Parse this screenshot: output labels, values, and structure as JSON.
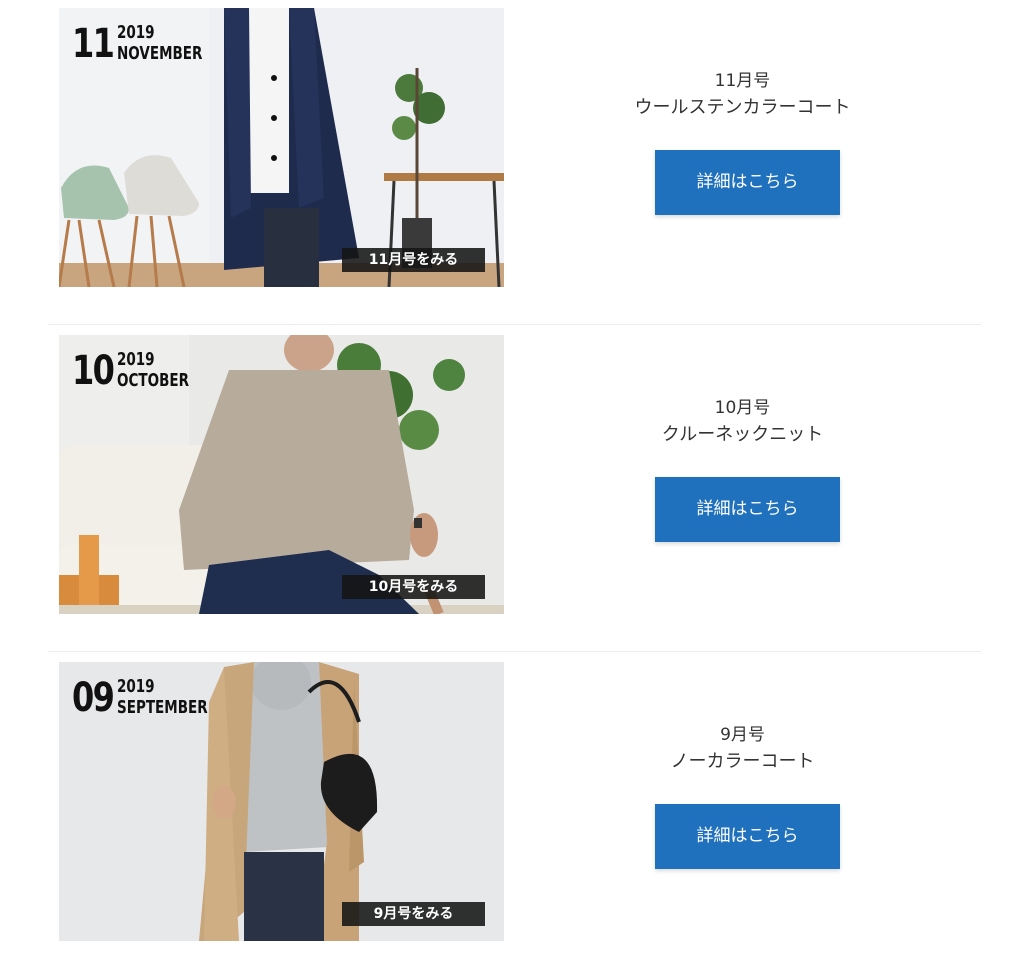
{
  "issues": [
    {
      "day": "11",
      "year": "2019",
      "month": "NOVEMBER",
      "view_label": "11月号をみる",
      "issue_label": "11月号",
      "title": "ウールステンカラーコート",
      "button_label": "詳細はこちら",
      "photo_subject": "man in navy wool coat beside chairs and plant"
    },
    {
      "day": "10",
      "year": "2019",
      "month": "OCTOBER",
      "view_label": "10月号をみる",
      "issue_label": "10月号",
      "title": "クルーネックニット",
      "button_label": "詳細はこちら",
      "photo_subject": "man in beige knit sweater seated on sofa with plant"
    },
    {
      "day": "09",
      "year": "2019",
      "month": "SEPTEMBER",
      "view_label": "9月号をみる",
      "issue_label": "9月号",
      "title": "ノーカラーコート",
      "button_label": "詳細はこちら",
      "photo_subject": "man in beige collarless coat with grey hoodie and black bag"
    }
  ],
  "colors": {
    "button": "#1f70bd",
    "divider": "#ececec",
    "text": "#333333"
  }
}
